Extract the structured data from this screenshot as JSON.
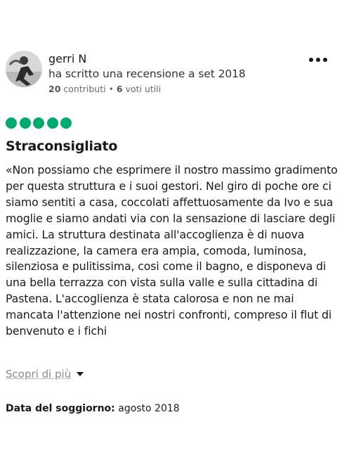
{
  "review": {
    "user": {
      "name": "gerri N",
      "wrote_text": "ha scritto una recensione a set 2018",
      "contributions_count": "20",
      "contributions_label": "contributi",
      "separator": "•",
      "helpful_votes_count": "6",
      "helpful_votes_label": "voti utili"
    },
    "rating": {
      "value": 5,
      "max": 5,
      "color": "#00aa6c"
    },
    "title": "Straconsigliato",
    "body": "«Non possiamo che esprimere il nostro massimo gradimento per questa struttura e i suoi gestori. Nel giro di poche ore ci siamo sentiti a casa, coccolati affettuosamente da Ivo e sua moglie e siamo andati via con la sensazione di lasciare degli amici. La struttura destinata all'accoglienza è di nuova realizzazione, la camera era ampia, comoda, luminosa, silenziosa e pulitissima, cosi come il bagno, e disponeva di una bella terrazza con vista sulla valle e sulla cittadina di Pastena. L'accoglienza è stata calorosa e non ne mai mancata l'attenzione nei nostri confronti, compreso il flut di benvenuto e i fichi",
    "read_more_label": "Scopri di più",
    "stay_label": "Data del soggiorno:",
    "stay_value": "agosto 2018",
    "icons": {
      "options": "more-horizontal-icon",
      "expand": "chevron-down-icon"
    }
  }
}
